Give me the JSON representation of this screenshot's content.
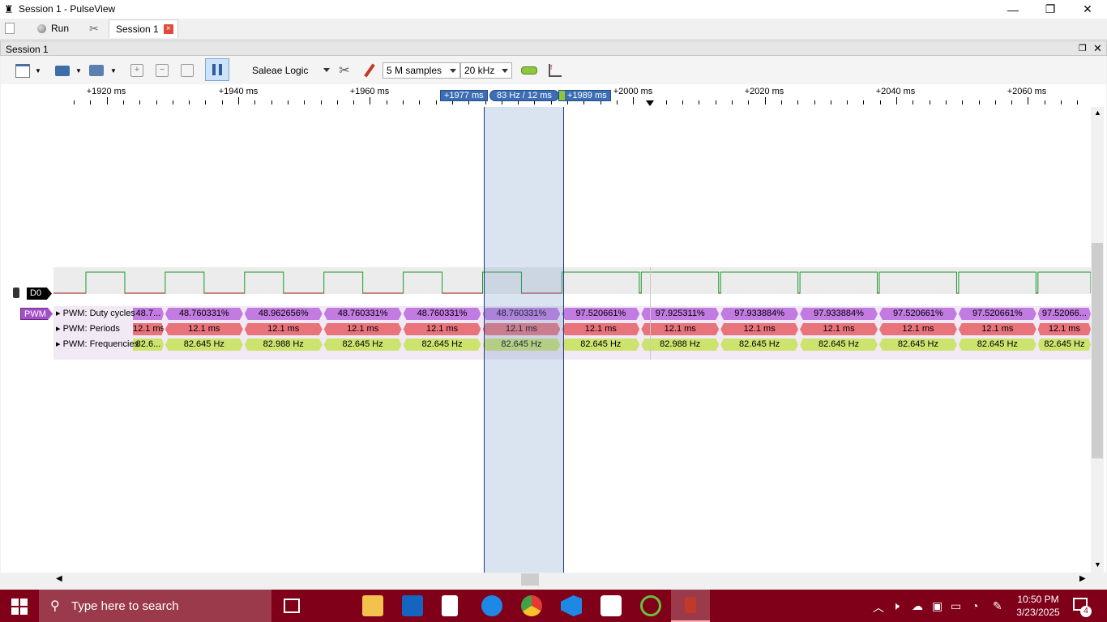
{
  "window": {
    "title": "Session 1 - PulseView"
  },
  "tabs": {
    "run_label": "Run",
    "session_tab_label": "Session 1",
    "close_glyph": "×"
  },
  "dock": {
    "title": "Session 1"
  },
  "toolbar": {
    "device": "Saleae Logic",
    "samples": "5 M samples",
    "rate": "20 kHz"
  },
  "ruler": {
    "ticks": [
      "+1920 ms",
      "+1940 ms",
      "+1960 ms",
      "+2000 ms",
      "+2020 ms",
      "+2040 ms",
      "+2060 ms"
    ],
    "cursor_a": "+1977 ms",
    "cursor_mid": "83 Hz / 12 ms",
    "cursor_b": "+1989 ms"
  },
  "channels": {
    "d0_label": "D0",
    "pwm_label": "PWM",
    "row_duty_label": "PWM: Duty cycles",
    "row_period_label": "PWM: Periods",
    "row_freq_label": "PWM: Frequencies"
  },
  "annotations": {
    "duty": [
      "48.7...",
      "48.760331%",
      "48.962656%",
      "48.760331%",
      "48.760331%",
      "48.760331%",
      "97.520661%",
      "97.925311%",
      "97.933884%",
      "97.933884%",
      "97.520661%",
      "97.520661%",
      "97.52066..."
    ],
    "period": [
      "12.1 ms",
      "12.1 ms",
      "12.1 ms",
      "12.1 ms",
      "12.1 ms",
      "12.1 ms",
      "12.1 ms",
      "12.1 ms",
      "12.1 ms",
      "12.1 ms",
      "12.1 ms",
      "12.1 ms",
      "12.1 ms"
    ],
    "freq": [
      "82.6...",
      "82.645 Hz",
      "82.988 Hz",
      "82.645 Hz",
      "82.645 Hz",
      "82.645 Hz",
      "82.645 Hz",
      "82.988 Hz",
      "82.645 Hz",
      "82.645 Hz",
      "82.645 Hz",
      "82.645 Hz",
      "82.645 Hz"
    ]
  },
  "colors": {
    "duty": "#c27be0",
    "period": "#e8737a",
    "freq": "#cce36e",
    "taskbar": "#80001a"
  },
  "taskbar": {
    "search_placeholder": "Type here to search",
    "time": "10:50 PM",
    "date": "3/23/2025",
    "notif_count": "4"
  }
}
